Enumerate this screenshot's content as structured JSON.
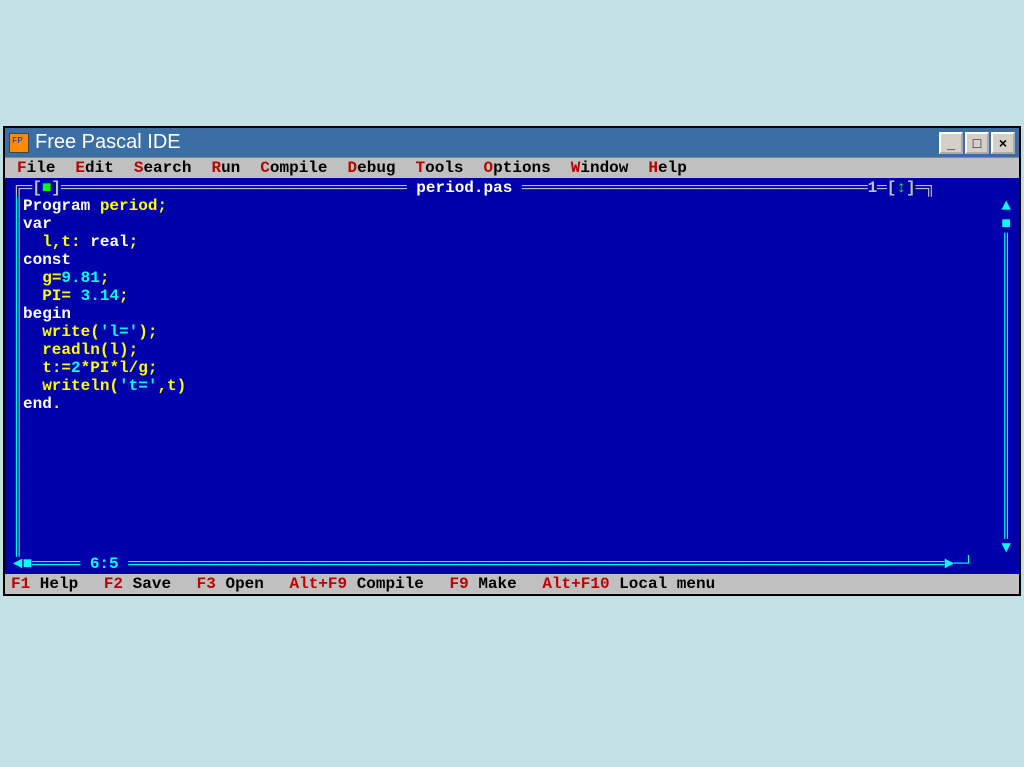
{
  "window": {
    "title": "Free Pascal IDE"
  },
  "menu": {
    "items": [
      {
        "hotkey": "F",
        "rest": "ile"
      },
      {
        "hotkey": "E",
        "rest": "dit"
      },
      {
        "hotkey": "S",
        "rest": "earch"
      },
      {
        "hotkey": "R",
        "rest": "un"
      },
      {
        "hotkey": "C",
        "rest": "ompile"
      },
      {
        "hotkey": "D",
        "rest": "ebug"
      },
      {
        "hotkey": "T",
        "rest": "ools"
      },
      {
        "hotkey": "O",
        "rest": "ptions"
      },
      {
        "hotkey": "W",
        "rest": "indow"
      },
      {
        "hotkey": "H",
        "rest": "elp"
      }
    ]
  },
  "editor": {
    "filename": "period.pas",
    "window_number": "1",
    "cursor_pos": "6:5",
    "code_lines": [
      [
        {
          "c": "kw",
          "t": "Program "
        },
        {
          "c": "ident",
          "t": "period"
        },
        {
          "c": "punct",
          "t": ";"
        }
      ],
      [
        {
          "c": "kw",
          "t": "var"
        }
      ],
      [
        {
          "c": "ident",
          "t": "  l"
        },
        {
          "c": "punct",
          "t": ","
        },
        {
          "c": "ident",
          "t": "t"
        },
        {
          "c": "punct",
          "t": ": "
        },
        {
          "c": "kw",
          "t": "real"
        },
        {
          "c": "punct",
          "t": ";"
        }
      ],
      [
        {
          "c": "kw",
          "t": "const"
        }
      ],
      [
        {
          "c": "ident",
          "t": "  g"
        },
        {
          "c": "punct",
          "t": "="
        },
        {
          "c": "num",
          "t": "9.81"
        },
        {
          "c": "punct",
          "t": ";"
        }
      ],
      [
        {
          "c": "ident",
          "t": "  PI"
        },
        {
          "c": "punct",
          "t": "= "
        },
        {
          "c": "num",
          "t": "3.14"
        },
        {
          "c": "punct",
          "t": ";"
        }
      ],
      [
        {
          "c": "kw",
          "t": "begin"
        }
      ],
      [
        {
          "c": "ident",
          "t": "  write"
        },
        {
          "c": "punct",
          "t": "("
        },
        {
          "c": "str",
          "t": "'l='"
        },
        {
          "c": "punct",
          "t": ");"
        }
      ],
      [
        {
          "c": "ident",
          "t": "  readln"
        },
        {
          "c": "punct",
          "t": "("
        },
        {
          "c": "ident",
          "t": "l"
        },
        {
          "c": "punct",
          "t": ");"
        }
      ],
      [
        {
          "c": "ident",
          "t": "  t"
        },
        {
          "c": "punct",
          "t": ":="
        },
        {
          "c": "num",
          "t": "2"
        },
        {
          "c": "punct",
          "t": "*"
        },
        {
          "c": "ident",
          "t": "PI"
        },
        {
          "c": "punct",
          "t": "*"
        },
        {
          "c": "ident",
          "t": "l"
        },
        {
          "c": "punct",
          "t": "/"
        },
        {
          "c": "ident",
          "t": "g"
        },
        {
          "c": "punct",
          "t": ";"
        }
      ],
      [
        {
          "c": "ident",
          "t": "  writeln"
        },
        {
          "c": "punct",
          "t": "("
        },
        {
          "c": "str",
          "t": "'t='"
        },
        {
          "c": "punct",
          "t": ","
        },
        {
          "c": "ident",
          "t": "t"
        },
        {
          "c": "punct",
          "t": ")"
        }
      ],
      [
        {
          "c": "kw",
          "t": "end"
        },
        {
          "c": "punct",
          "t": "."
        }
      ]
    ]
  },
  "status": {
    "items": [
      {
        "key": "F1",
        "label": " Help"
      },
      {
        "key": "F2",
        "label": " Save"
      },
      {
        "key": "F3",
        "label": " Open"
      },
      {
        "key": "Alt+F9",
        "label": " Compile"
      },
      {
        "key": "F9",
        "label": " Make"
      },
      {
        "key": "Alt+F10",
        "label": " Local menu"
      }
    ]
  }
}
